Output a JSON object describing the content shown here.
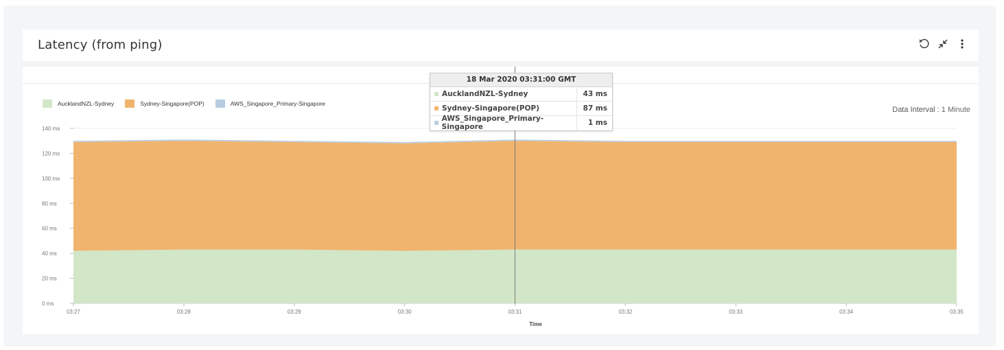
{
  "widget": {
    "title": "Latency (from ping)",
    "icons": [
      "refresh-icon",
      "collapse-icon",
      "more-vertical-icon"
    ]
  },
  "data_interval": {
    "label": "Data Interval",
    "value": "1 Minute"
  },
  "tooltip": {
    "title": "18 Mar 2020 03:31:00 GMT",
    "rows": [
      {
        "name": "AucklandNZL-Sydney",
        "value": "43 ms",
        "color": "#d2e6c8"
      },
      {
        "name": "Sydney-Singapore(POP)",
        "value": "87 ms",
        "color": "#f0b46e"
      },
      {
        "name": "AWS_Singapore_Primary-Singapore",
        "value": "1 ms",
        "color": "#b8cde0"
      }
    ]
  },
  "chart_data": {
    "type": "area",
    "stacked": true,
    "xlabel": "Time",
    "ylabel": "",
    "ylim": [
      0,
      140
    ],
    "yticks": [
      "0 ms",
      "20 ms",
      "40 ms",
      "60 ms",
      "80 ms",
      "100 ms",
      "120 ms",
      "140 ms"
    ],
    "x": [
      "03:27",
      "03:28",
      "03:29",
      "03:30",
      "03:31",
      "03:32",
      "03:33",
      "03:34",
      "03:35"
    ],
    "legend_position": "top-left",
    "series": [
      {
        "name": "AucklandNZL-Sydney",
        "color": "#d2e6c8",
        "values": [
          42,
          43,
          43,
          42,
          43,
          43,
          43,
          43,
          43
        ]
      },
      {
        "name": "Sydney-Singapore(POP)",
        "color": "#f0b46e",
        "values": [
          87,
          87,
          86,
          86,
          87,
          86,
          86,
          86,
          86
        ]
      },
      {
        "name": "AWS_Singapore_Primary-Singapore",
        "color": "#b8cde0",
        "values": [
          1,
          1,
          1,
          1,
          1,
          1,
          1,
          1,
          1
        ]
      }
    ]
  }
}
